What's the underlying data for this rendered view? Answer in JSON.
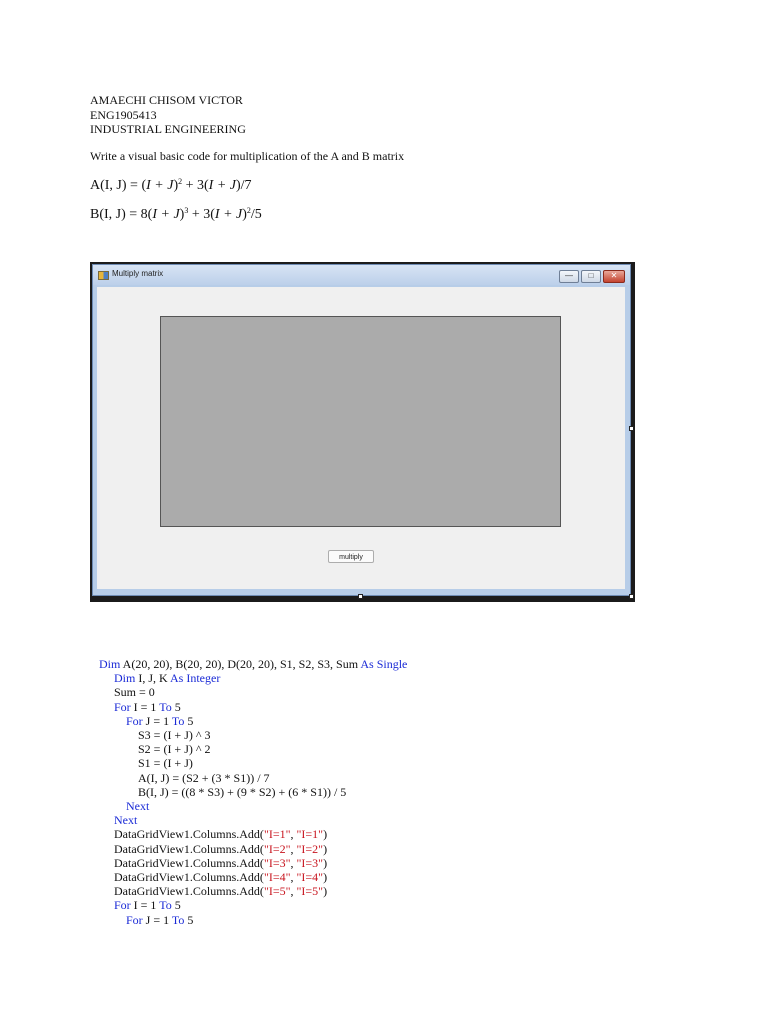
{
  "header": {
    "name": "AMAECHI CHISOM VICTOR",
    "reg_no": "ENG1905413",
    "department": "INDUSTRIAL ENGINEERING"
  },
  "task": "Write a visual basic code for multiplication of the A and B matrix",
  "equations": {
    "a": {
      "lhs": "A(I, J) = (",
      "v1": "I + J",
      "m1": ")",
      "exp1": "2",
      "m2": " + 3(",
      "v2": "I + J",
      "tail": ")/7"
    },
    "b": {
      "lhs": "B(I, J) = 8(",
      "v1": "I + J",
      "m1": ")",
      "exp1": "3",
      "m2": " + 3(",
      "v2": "I + J",
      "m3": ")",
      "exp2": "2",
      "tail": "/5"
    }
  },
  "form": {
    "title": "Multiply matrix",
    "minimize_glyph": "—",
    "maximize_glyph": "□",
    "close_glyph": "✕",
    "button_label": "multiply"
  },
  "code": {
    "l1": {
      "kw1": "Dim",
      "text": " A(20, 20), B(20, 20), D(20, 20), S1, S2, S3, Sum ",
      "kw2": "As Single"
    },
    "l2": {
      "kw1": "Dim",
      "text": " I, J, K ",
      "kw2": "As Integer"
    },
    "l3": "Sum = 0",
    "l4": {
      "kw1": "For",
      "t1": " I = 1 ",
      "kw2": "To",
      "t2": " 5"
    },
    "l5": {
      "kw1": "For",
      "t1": " J = 1 ",
      "kw2": "To",
      "t2": " 5"
    },
    "l6": "S3 = (I + J) ^ 3",
    "l7": "S2 = (I + J) ^ 2",
    "l8": "S1 = (I + J)",
    "l9": "A(I, J) = (S2 + (3 * S1)) / 7",
    "l10": "B(I, J) = ((8 * S3) + (9 * S2) + (6 * S1)) / 5",
    "l11": "Next",
    "l12": "Next",
    "add_prefix": "DataGridView1.Columns.Add(",
    "comma": ", ",
    "close_paren": ")",
    "columns": [
      {
        "a": "\"I=1\"",
        "b": "\"I=1\""
      },
      {
        "a": "\"I=2\"",
        "b": "\"I=2\""
      },
      {
        "a": "\"I=3\"",
        "b": "\"I=3\""
      },
      {
        "a": "\"I=4\"",
        "b": "\"I=4\""
      },
      {
        "a": "\"I=5\"",
        "b": "\"I=5\""
      }
    ],
    "l18": {
      "kw1": "For",
      "t1": " I = 1 ",
      "kw2": "To",
      "t2": " 5"
    },
    "l19": {
      "kw1": "For",
      "t1": " J = 1 ",
      "kw2": "To",
      "t2": " 5"
    }
  }
}
